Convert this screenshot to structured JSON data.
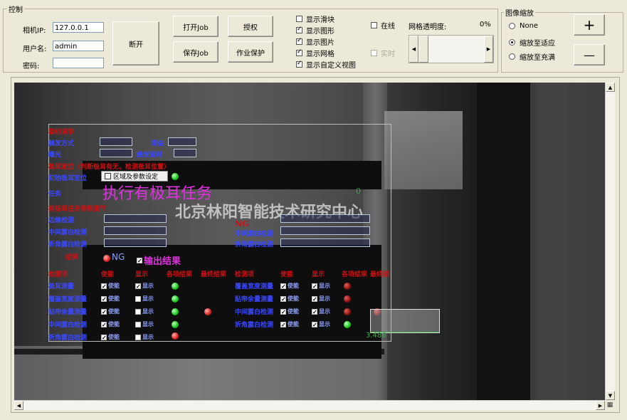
{
  "control": {
    "group_title": "控制",
    "camera_ip_label": "相机IP:",
    "camera_ip_value": "127.0.0.1",
    "username_label": "用户名:",
    "username_value": "admin",
    "password_label": "密码:",
    "password_value": "",
    "disconnect_label": "断开",
    "open_job_label": "打开Job",
    "save_job_label": "保存Job",
    "authorize_label": "授权",
    "job_protect_label": "作业保护"
  },
  "display_options": [
    {
      "label": "显示滑块",
      "checked": false
    },
    {
      "label": "显示图形",
      "checked": true
    },
    {
      "label": "显示图片",
      "checked": true
    },
    {
      "label": "显示网格",
      "checked": true
    },
    {
      "label": "显示自定义视图",
      "checked": true
    }
  ],
  "online": {
    "label": "在线",
    "checked": false
  },
  "realtime": {
    "label": "实时",
    "checked": false
  },
  "grid_opacity": {
    "label": "网格透明度:",
    "value": "0%"
  },
  "zoom": {
    "group_title": "图像缩放",
    "options": [
      {
        "label": "None",
        "selected": false
      },
      {
        "label": "缩放至适应",
        "selected": true
      },
      {
        "label": "缩放至充满",
        "selected": false
      }
    ],
    "plus_label": "+",
    "minus_label": "—"
  },
  "overlay": {
    "camera_adjust": "相机调节",
    "trigger_mode": "触发方式",
    "gain": "增益",
    "exposure": "曝光",
    "trigger_delay": "触发延时",
    "tab_locate_title": "极耳定位（判断极耳有无，检测极耳位置）",
    "init_locate": "初始极耳定位",
    "region_param_btn": "区域及参数设定",
    "task_label": "任务",
    "task_text": "执行有极耳任务",
    "task_param_title": "有极耳任务参数调节",
    "edge_detect": "边缘检测",
    "mid_white_detect": "中间露白检测",
    "fold_white_detect": "折角露白检测",
    "watermark": "北京林阳智能技术研究中心",
    "result_label": "结果",
    "result_value": "NG",
    "output_result": "输出结果",
    "ng_right": "NG",
    "col_headers_left": [
      "检测项",
      "使能",
      "显示",
      "各项结果",
      "最终结果"
    ],
    "col_headers_right": [
      "检测项",
      "使能",
      "显示",
      "各项结果",
      "最终结"
    ],
    "rows_left": [
      "极耳测量",
      "覆盖宽度测量",
      "贴带余量测量",
      "中间露白检测",
      "折角露白检测"
    ],
    "rows_right": [
      "覆盖宽度测量",
      "贴带余量测量",
      "中间露白检测",
      "折角露白检测"
    ],
    "enable_label": "使能",
    "show_label": "显示",
    "measure_value": "3.486",
    "top_right_value": "0"
  }
}
